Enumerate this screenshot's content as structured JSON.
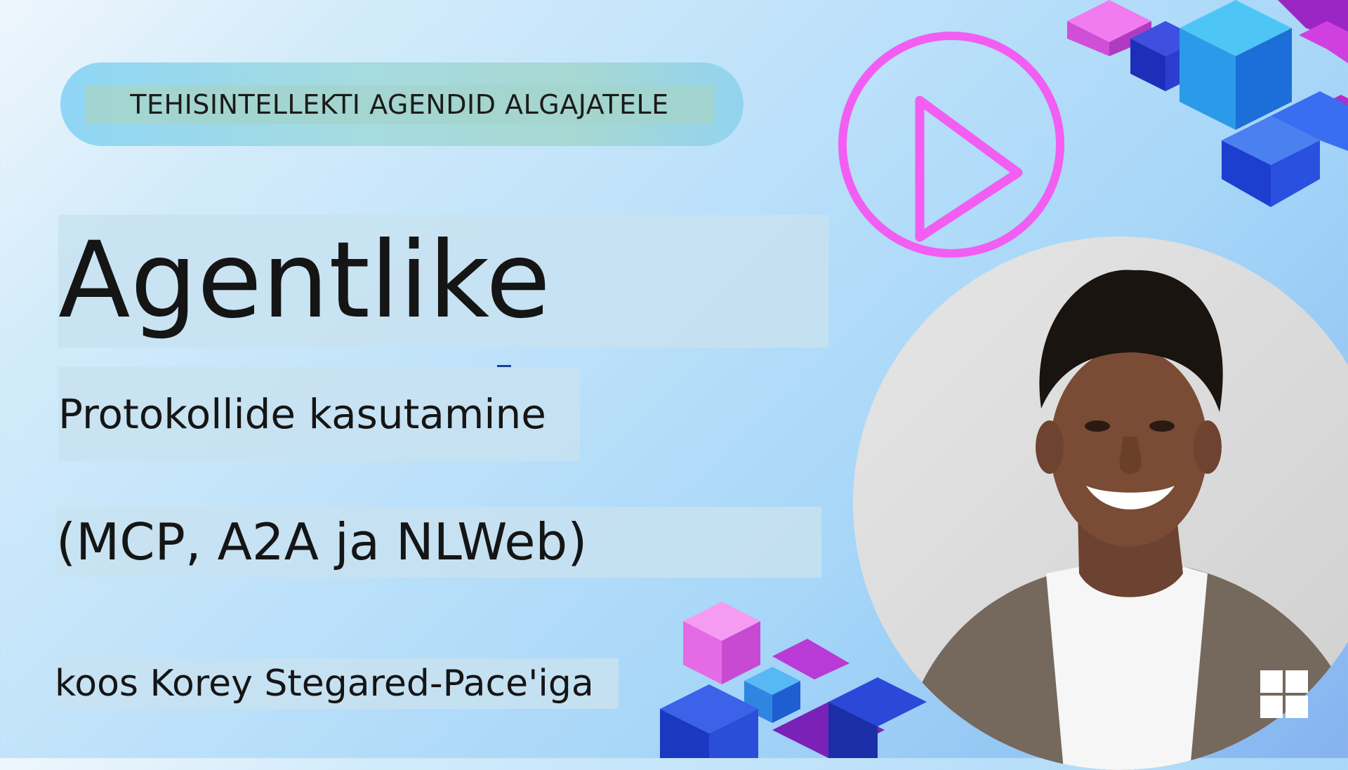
{
  "series": {
    "label": "TEHISINTELLEKTI AGENDID ALGAJATELE"
  },
  "lesson": {
    "title": "Agentlike",
    "subtitle_line1": "Protokollide kasutamine",
    "subtitle_line2": "(MCP, A2A ja NLWeb)",
    "host": "koos Korey Stegared-Pace'iga"
  },
  "icons": {
    "play": "play-circle-icon",
    "brand": "microsoft-logo-icon",
    "decoration": "cube-cluster"
  },
  "colors": {
    "accent_magenta": "#f25ef2",
    "cube_blue": "#2a5be8",
    "cube_purple": "#b42fd6",
    "background_light": "#d2ebfa",
    "background_blue": "#86b2f0"
  }
}
